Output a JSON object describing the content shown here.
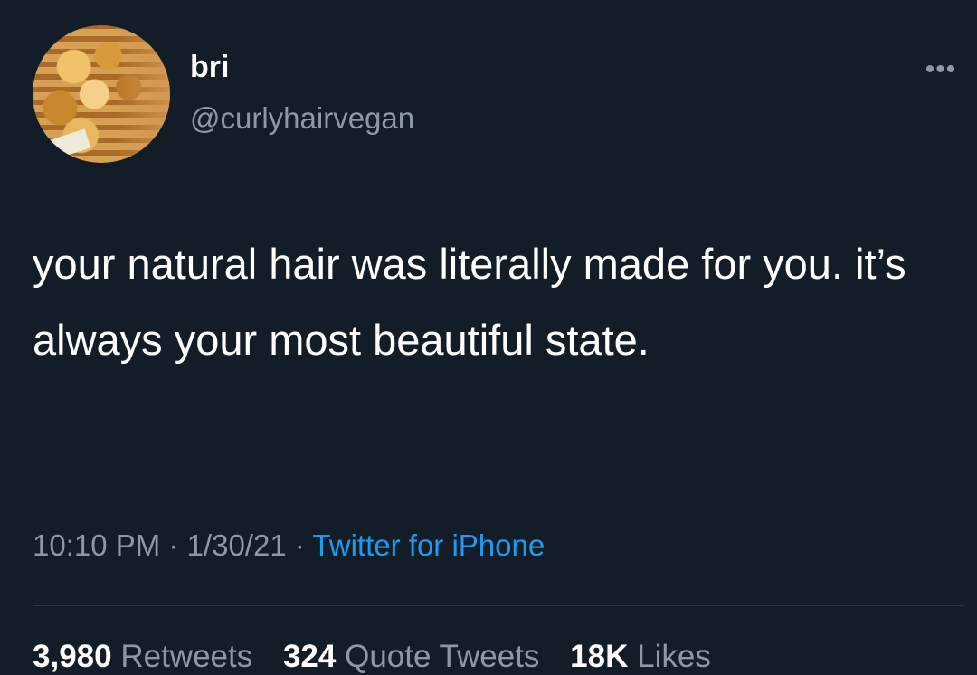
{
  "tweet": {
    "author": {
      "name": "bri",
      "handle": "@curlyhairvegan"
    },
    "more_icon": "more-dots-icon",
    "more_glyph": "•••",
    "text": "your natural hair was literally made for you. it’s always your most beautiful state.",
    "time": "10:10 PM",
    "separator": " · ",
    "date": "1/30/21",
    "source": "Twitter for iPhone",
    "stats": {
      "retweets_count": "3,980",
      "retweets_label": "Retweets",
      "quotes_count": "324",
      "quotes_label": "Quote Tweets",
      "likes_count": "18K",
      "likes_label": "Likes"
    }
  },
  "colors": {
    "background": "#131d28",
    "primary_text": "#ffffff",
    "secondary_text": "#8b98a5",
    "accent": "#1d9bf0"
  }
}
